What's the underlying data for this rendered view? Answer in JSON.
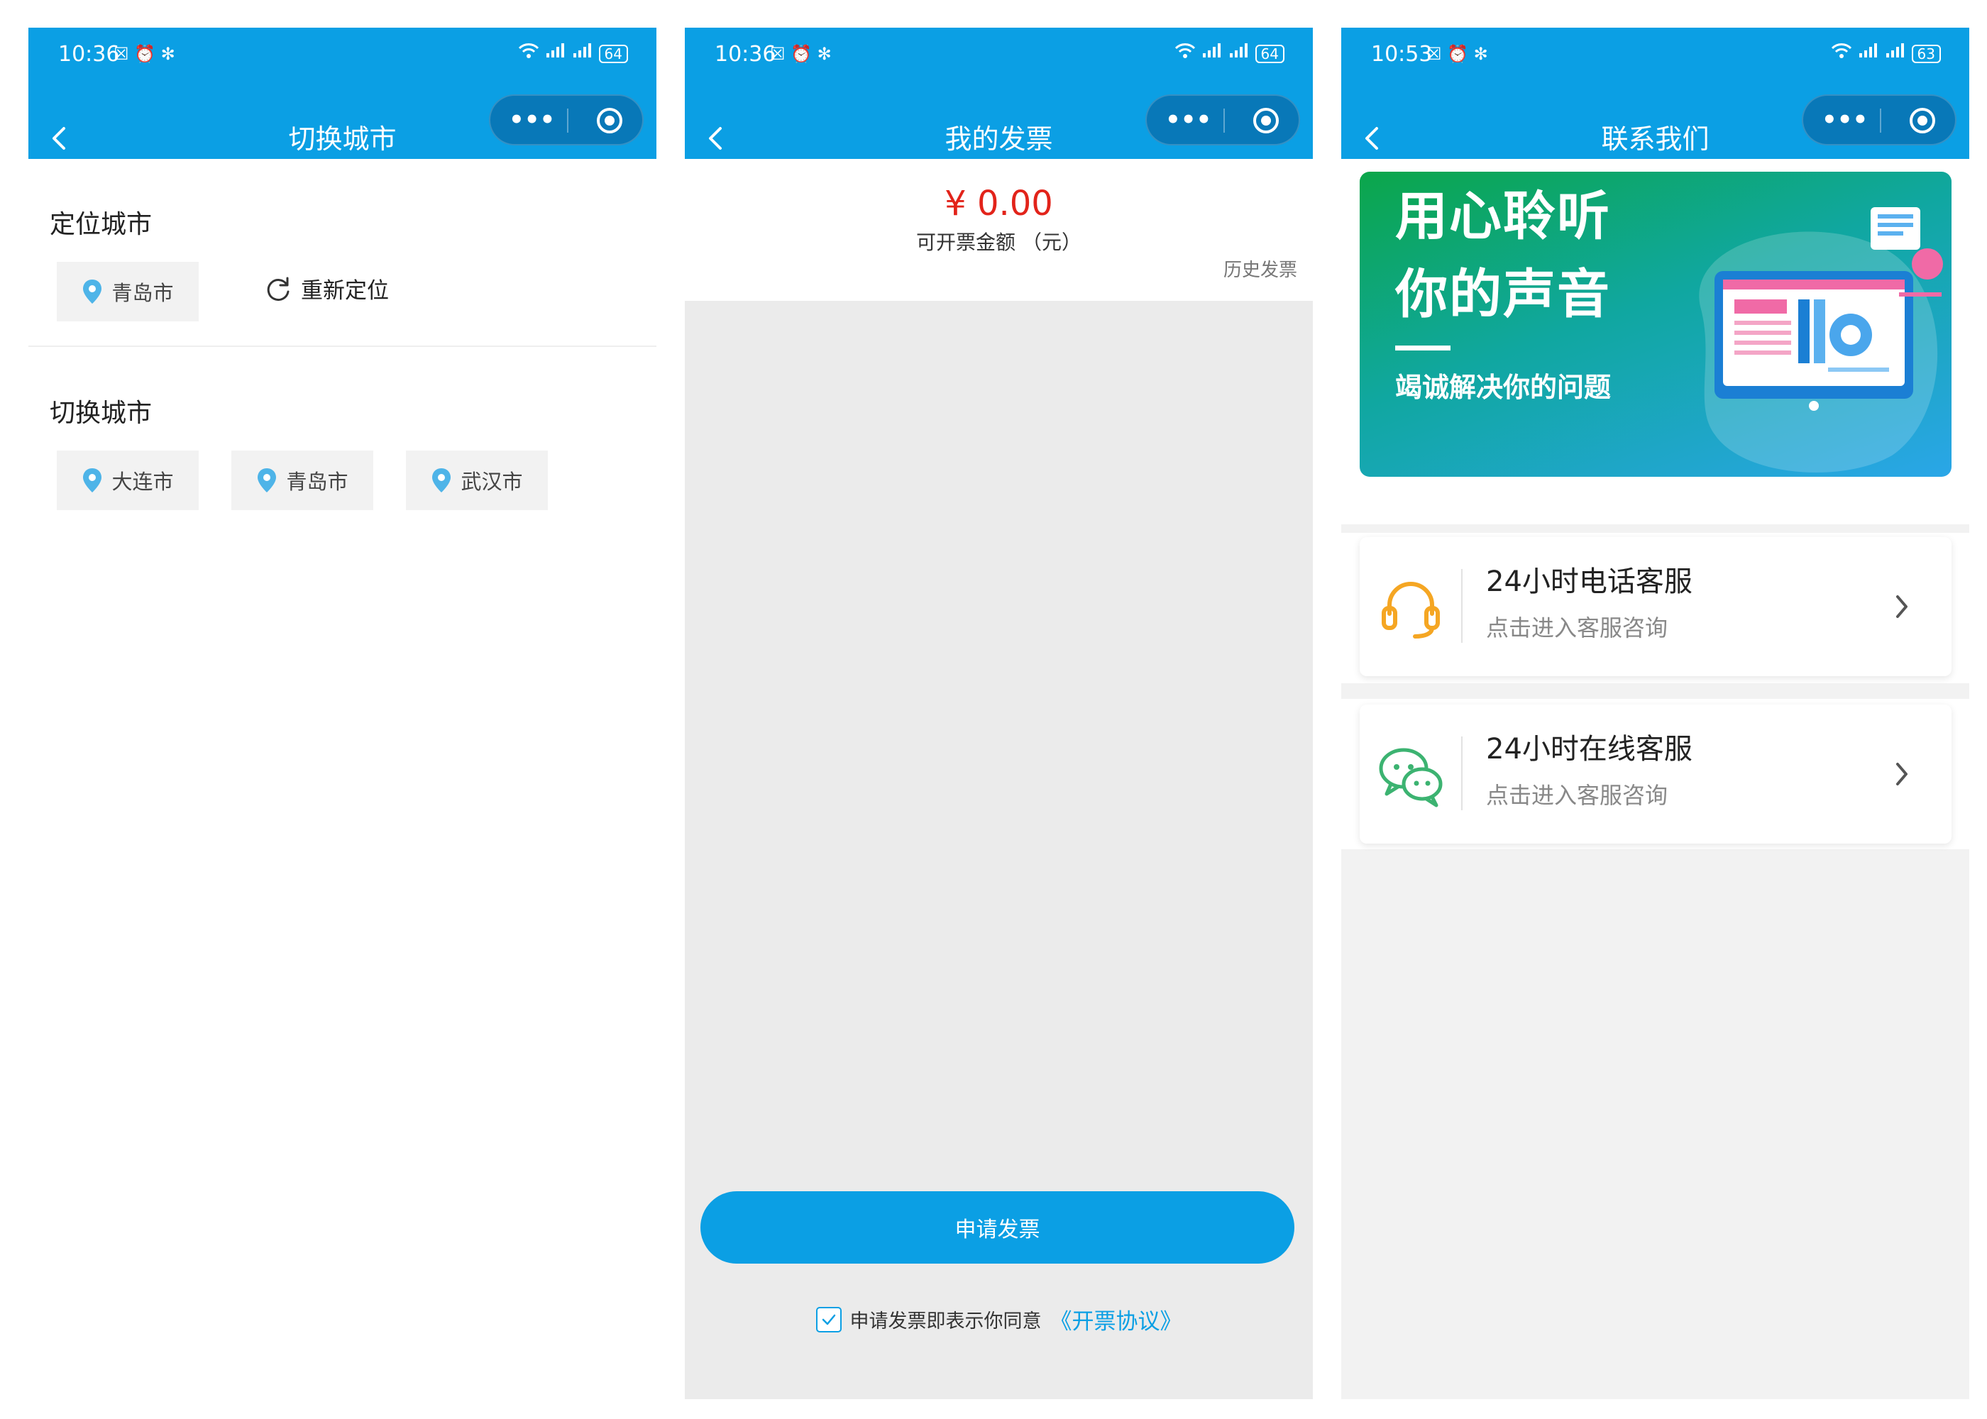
{
  "screens": [
    {
      "status": {
        "time": "10:36",
        "extra": "☒ ⏰ ✻",
        "battery": "64"
      },
      "nav_title": "切换城市",
      "capsule_more": "•••",
      "located_section": "定位城市",
      "located_city": "青岛市",
      "relocate_label": "重新定位",
      "switch_section": "切换城市",
      "cities": [
        "大连市",
        "青岛市",
        "武汉市"
      ]
    },
    {
      "status": {
        "time": "10:36",
        "extra": "☒ ⏰ ✻",
        "battery": "64"
      },
      "nav_title": "我的发票",
      "capsule_more": "•••",
      "amount": "¥ 0.00",
      "amount_label": "可开票金额 （元）",
      "history_link": "历史发票",
      "apply_button": "申请发票",
      "agree_text": "申请发票即表示你同意",
      "agree_link": "《开票协议》",
      "agree_checked": true
    },
    {
      "status": {
        "time": "10:53",
        "extra": "☒ ⏰ ✻",
        "battery": "63"
      },
      "nav_title": "联系我们",
      "capsule_more": "•••",
      "banner": {
        "line1": "用心聆听",
        "line2": "你的声音",
        "subtitle": "竭诚解决你的问题"
      },
      "services": [
        {
          "title": "24小时电话客服",
          "subtitle": "点击进入客服咨询",
          "icon": "headset-icon"
        },
        {
          "title": "24小时在线客服",
          "subtitle": "点击进入客服咨询",
          "icon": "wechat-icon"
        }
      ]
    }
  ],
  "colors": {
    "brand_blue": "#0b9fe4",
    "capsule_blue": "#0878b8",
    "price_red": "#e2231a",
    "pin_blue": "#4eb4e8",
    "headset_orange": "#f5a623",
    "wechat_green": "#3cb371"
  }
}
